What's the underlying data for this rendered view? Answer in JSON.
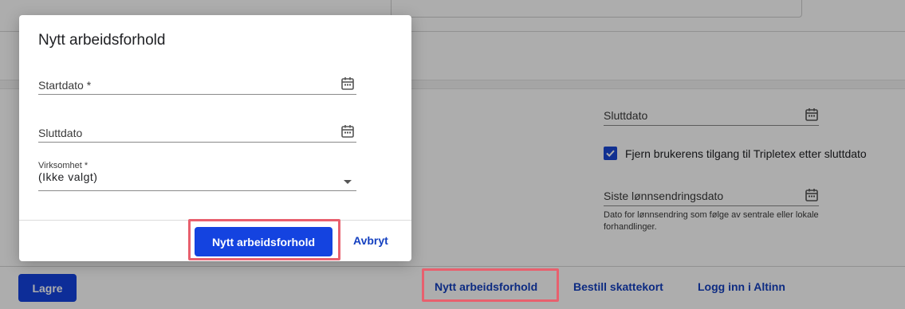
{
  "background": {
    "sluttdato_label": "Sluttdato",
    "checkbox_label": "Fjern brukerens tilgang til Tripletex etter sluttdato",
    "siste_lonn_label": "Siste lønnsendringsdato",
    "siste_lonn_help": "Dato for lønnsendring som følge av sentrale eller lokale forhandlinger."
  },
  "footer": {
    "save_label": "Lagre",
    "new_employment_label": "Nytt arbeidsforhold",
    "tax_card_label": "Bestill skattekort",
    "altinn_label": "Logg inn i Altinn"
  },
  "dialog": {
    "title": "Nytt arbeidsforhold",
    "start_label": "Startdato *",
    "end_label": "Sluttdato",
    "company_label": "Virksomhet *",
    "company_value": "(Ikke valgt)",
    "confirm_label": "Nytt arbeidsforhold",
    "cancel_label": "Avbryt"
  },
  "colors": {
    "primary": "#1443e0",
    "link": "#1440c0",
    "highlight": "#e8606e"
  },
  "icons": {
    "calendar": "calendar-icon",
    "checkmark": "check-icon",
    "dropdown": "chevron-down-icon"
  }
}
